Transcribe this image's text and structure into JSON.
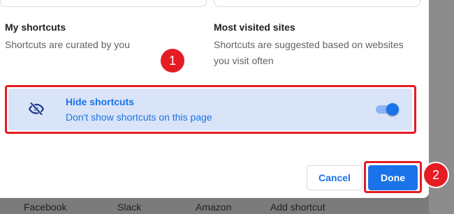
{
  "my_shortcuts": {
    "title": "My shortcuts",
    "description": "Shortcuts are curated by you"
  },
  "most_visited": {
    "title": "Most visited sites",
    "description_line1": "Shortcuts are suggested based on websites",
    "description_line2": "you visit often"
  },
  "hide_shortcuts": {
    "title": "Hide shortcuts",
    "subtitle": "Don't show shortcuts on this page",
    "icon": "eye-off-icon",
    "toggle_on": true
  },
  "buttons": {
    "cancel": "Cancel",
    "done": "Done"
  },
  "annotations": {
    "step1": "1",
    "step2": "2"
  },
  "background_shortcuts": [
    "Facebook",
    "Slack",
    "Amazon",
    "Add shortcut"
  ],
  "colors": {
    "accent": "#1a73e8",
    "highlight_bg": "#d9e4f8",
    "annotation_red": "#e51c23"
  }
}
